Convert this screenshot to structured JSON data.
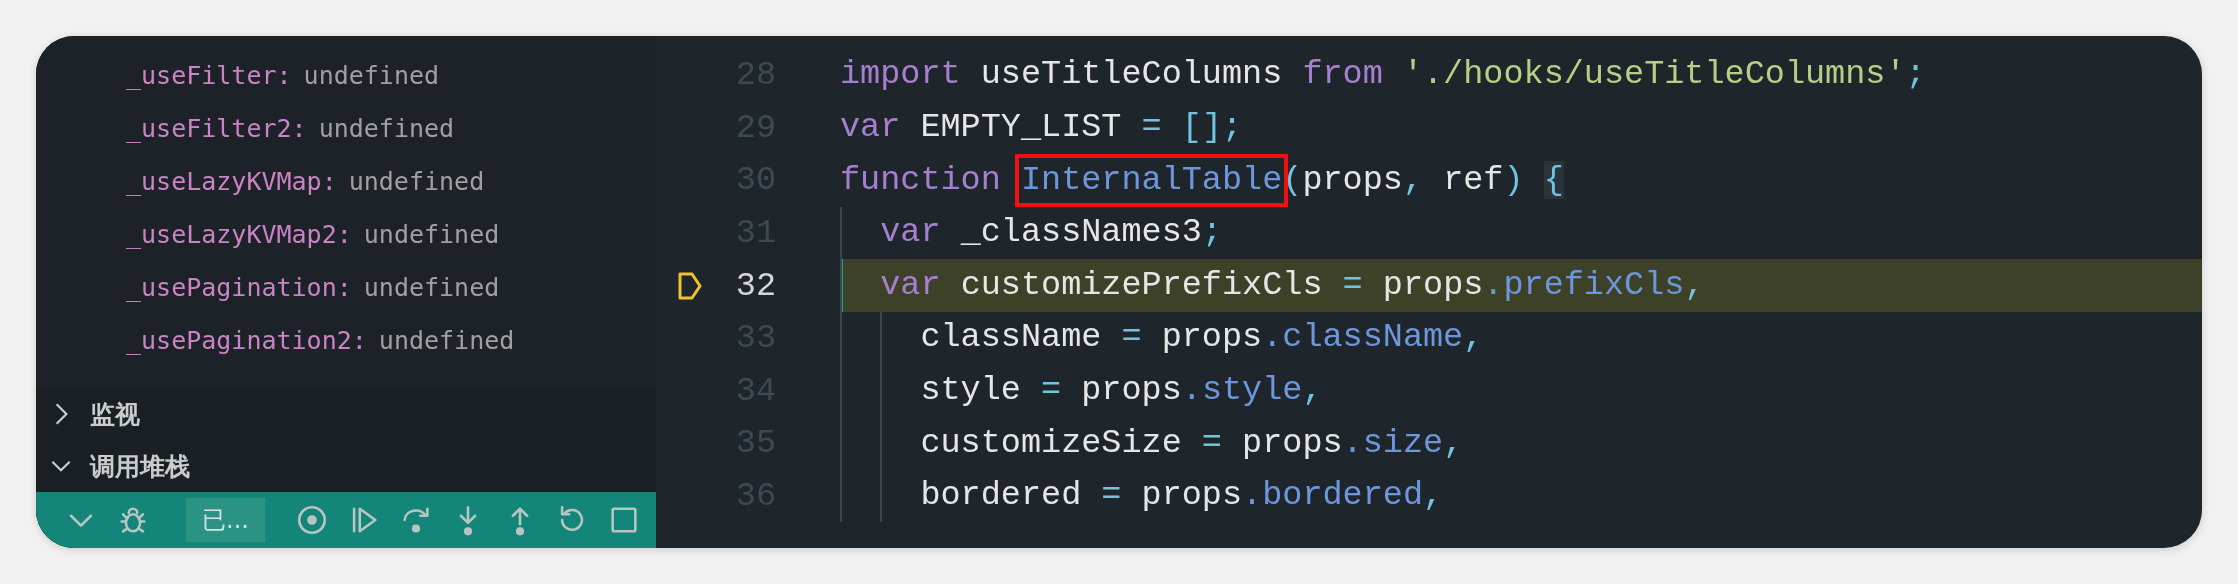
{
  "sidebar": {
    "variables": [
      {
        "name": "_useFilter:",
        "value": "undefined"
      },
      {
        "name": "_useFilter2:",
        "value": "undefined"
      },
      {
        "name": "_useLazyKVMap:",
        "value": "undefined"
      },
      {
        "name": "_useLazyKVMap2:",
        "value": "undefined"
      },
      {
        "name": "_usePagination:",
        "value": "undefined"
      },
      {
        "name": "_usePagination2:",
        "value": "undefined"
      }
    ],
    "sections": [
      {
        "label": "监视",
        "expanded": false
      },
      {
        "label": "调用堆栈",
        "expanded": true
      }
    ],
    "debug_toolbar": {
      "session": "已..."
    }
  },
  "editor": {
    "lines": [
      {
        "number": "28",
        "current": false,
        "tokens": [
          {
            "kind": "kw",
            "text": "import"
          },
          {
            "kind": "plain",
            "text": " useTitleColumns "
          },
          {
            "kind": "kw",
            "text": "from"
          },
          {
            "kind": "str",
            "text": " './hooks/useTitleColumns'"
          },
          {
            "kind": "punct",
            "text": ";"
          }
        ]
      },
      {
        "number": "29",
        "current": false,
        "tokens": [
          {
            "kind": "kw",
            "text": "var"
          },
          {
            "kind": "plain",
            "text": " EMPTY_LIST "
          },
          {
            "kind": "punct",
            "text": "="
          },
          {
            "kind": "punct",
            "text": " [];"
          }
        ]
      },
      {
        "number": "30",
        "current": false,
        "tokens": [
          {
            "kind": "kw",
            "text": "function "
          },
          {
            "kind": "fn",
            "text": "InternalTable",
            "boxed": true
          },
          {
            "kind": "punct",
            "text": "("
          },
          {
            "kind": "plain",
            "text": "props"
          },
          {
            "kind": "punct",
            "text": ","
          },
          {
            "kind": "plain",
            "text": " ref"
          },
          {
            "kind": "punct",
            "text": ") "
          },
          {
            "kind": "bracket",
            "text": "{"
          }
        ]
      },
      {
        "number": "31",
        "current": false,
        "tokens": [
          {
            "kind": "kw",
            "text": "  var"
          },
          {
            "kind": "plain",
            "text": " _classNames3"
          },
          {
            "kind": "punct",
            "text": ";"
          }
        ]
      },
      {
        "number": "32",
        "current": true,
        "tokens": [
          {
            "kind": "kw",
            "text": "  var"
          },
          {
            "kind": "plain",
            "text": " customizePrefixCls "
          },
          {
            "kind": "punct",
            "text": "="
          },
          {
            "kind": "plain",
            "text": " props"
          },
          {
            "kind": "prop",
            "text": ".prefixCls"
          },
          {
            "kind": "punct",
            "text": ","
          }
        ]
      },
      {
        "number": "33",
        "current": false,
        "tokens": [
          {
            "kind": "plain",
            "text": "    className "
          },
          {
            "kind": "punct",
            "text": "="
          },
          {
            "kind": "plain",
            "text": " props"
          },
          {
            "kind": "prop",
            "text": ".className"
          },
          {
            "kind": "punct",
            "text": ","
          }
        ]
      },
      {
        "number": "34",
        "current": false,
        "tokens": [
          {
            "kind": "plain",
            "text": "    style "
          },
          {
            "kind": "punct",
            "text": "="
          },
          {
            "kind": "plain",
            "text": " props"
          },
          {
            "kind": "prop",
            "text": ".style"
          },
          {
            "kind": "punct",
            "text": ","
          }
        ]
      },
      {
        "number": "35",
        "current": false,
        "tokens": [
          {
            "kind": "plain",
            "text": "    customizeSize "
          },
          {
            "kind": "punct",
            "text": "="
          },
          {
            "kind": "plain",
            "text": " props"
          },
          {
            "kind": "prop",
            "text": ".size"
          },
          {
            "kind": "punct",
            "text": ","
          }
        ]
      },
      {
        "number": "36",
        "current": false,
        "tokens": [
          {
            "kind": "plain",
            "text": "    bordered "
          },
          {
            "kind": "punct",
            "text": "="
          },
          {
            "kind": "plain",
            "text": " props"
          },
          {
            "kind": "prop",
            "text": ".bordered"
          },
          {
            "kind": "punct",
            "text": ","
          }
        ]
      }
    ]
  }
}
